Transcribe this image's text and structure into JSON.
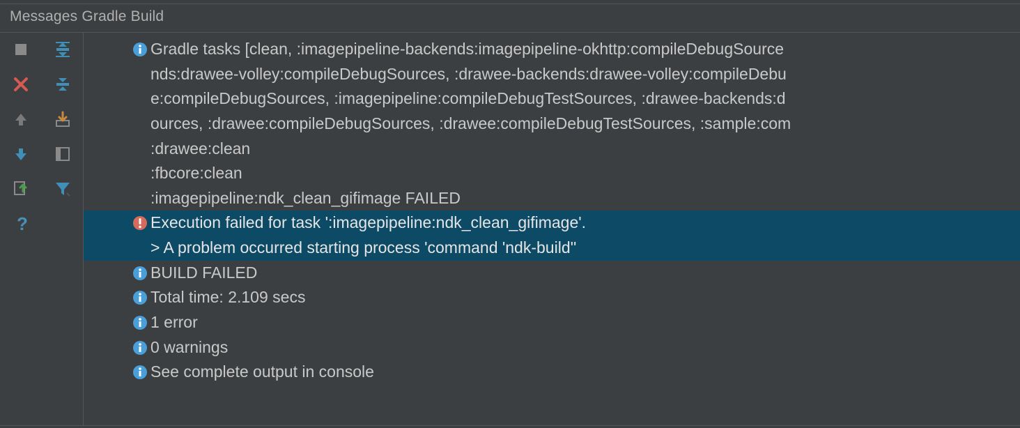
{
  "panel": {
    "title": "Messages Gradle Build"
  },
  "toolbar": {
    "col1": [
      "stop-icon",
      "close-icon",
      "arrow-up-icon",
      "arrow-down-icon",
      "export-icon",
      "help-icon"
    ],
    "col2": [
      "expand-all-icon",
      "collapse-all-icon",
      "import-icon",
      "layout-icon",
      "filter-icon"
    ]
  },
  "messages": {
    "tasks_header": "Gradle tasks [clean, :imagepipeline-backends:imagepipeline-okhttp:compileDebugSource",
    "tasks_wrap": [
      "nds:drawee-volley:compileDebugSources, :drawee-backends:drawee-volley:compileDebu",
      "e:compileDebugSources, :imagepipeline:compileDebugTestSources, :drawee-backends:d",
      "ources, :drawee:compileDebugSources, :drawee:compileDebugTestSources, :sample:com"
    ],
    "plain": [
      ":drawee:clean",
      ":fbcore:clean",
      ":imagepipeline:ndk_clean_gifimage FAILED"
    ],
    "error": {
      "line": "Execution failed for task ':imagepipeline:ndk_clean_gifimage'.",
      "detail": "> A problem occurred starting process 'command 'ndk-build''"
    },
    "footer": [
      "BUILD FAILED",
      "Total time: 2.109 secs",
      "1 error",
      "0 warnings",
      "See complete output in console"
    ]
  }
}
